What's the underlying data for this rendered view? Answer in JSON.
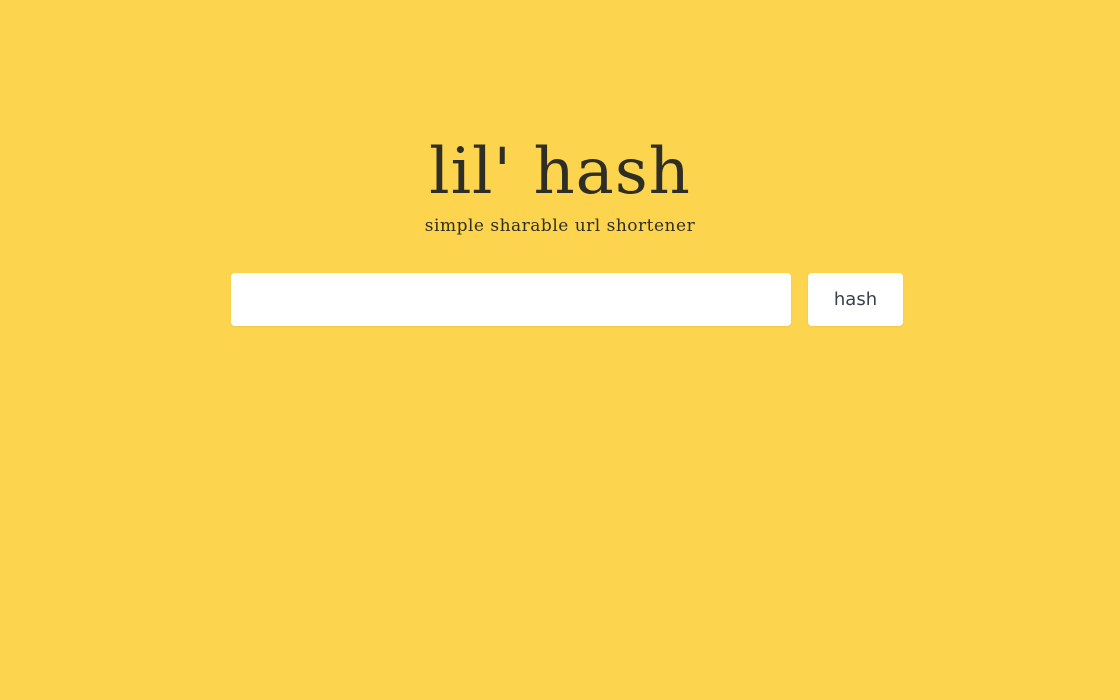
{
  "header": {
    "title": "lil' hash",
    "subtitle": "simple sharable url shortener"
  },
  "form": {
    "url_value": "",
    "url_placeholder": "",
    "submit_label": "hash"
  },
  "colors": {
    "background": "#fdd44d",
    "text": "#2f2e25",
    "surface": "#ffffff"
  }
}
